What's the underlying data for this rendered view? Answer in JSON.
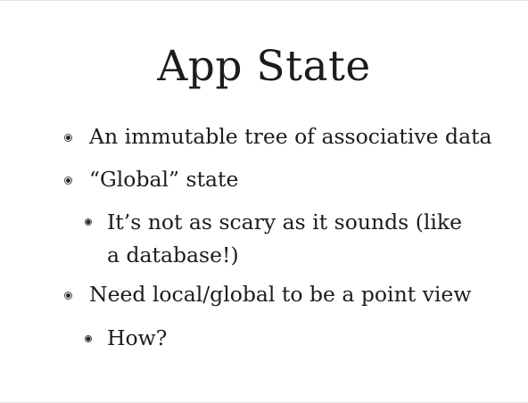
{
  "slide": {
    "title": "App State",
    "bullets": [
      {
        "level": 1,
        "text": "An immutable tree of associative data"
      },
      {
        "level": 1,
        "text": "“Global” state"
      },
      {
        "level": 2,
        "text": "It’s not as scary as it sounds (like a database!)"
      },
      {
        "level": 1,
        "text": "Need local/global to be a point view"
      },
      {
        "level": 2,
        "text": "How?"
      }
    ]
  }
}
